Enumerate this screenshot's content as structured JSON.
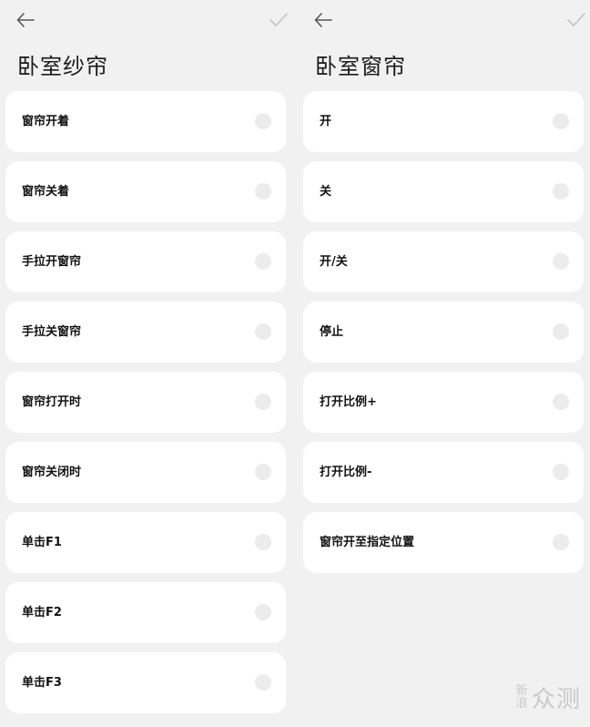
{
  "left_panel": {
    "title": "卧室纱帘",
    "items": [
      "窗帘开着",
      "窗帘关着",
      "手拉开窗帘",
      "手拉关窗帘",
      "窗帘打开时",
      "窗帘关闭时",
      "单击F1",
      "单击F2",
      "单击F3"
    ]
  },
  "right_panel": {
    "title": "卧室窗帘",
    "items": [
      "开",
      "关",
      "开/关",
      "停止",
      "打开比例+",
      "打开比例-",
      "窗帘开至指定位置"
    ]
  },
  "watermark": {
    "small": "新浪",
    "big": "众测"
  },
  "colors": {
    "background": "#f1f1f1",
    "card": "#ffffff",
    "radio": "#ececec",
    "icon": "#555555",
    "check_disabled": "#c4c4c4"
  }
}
